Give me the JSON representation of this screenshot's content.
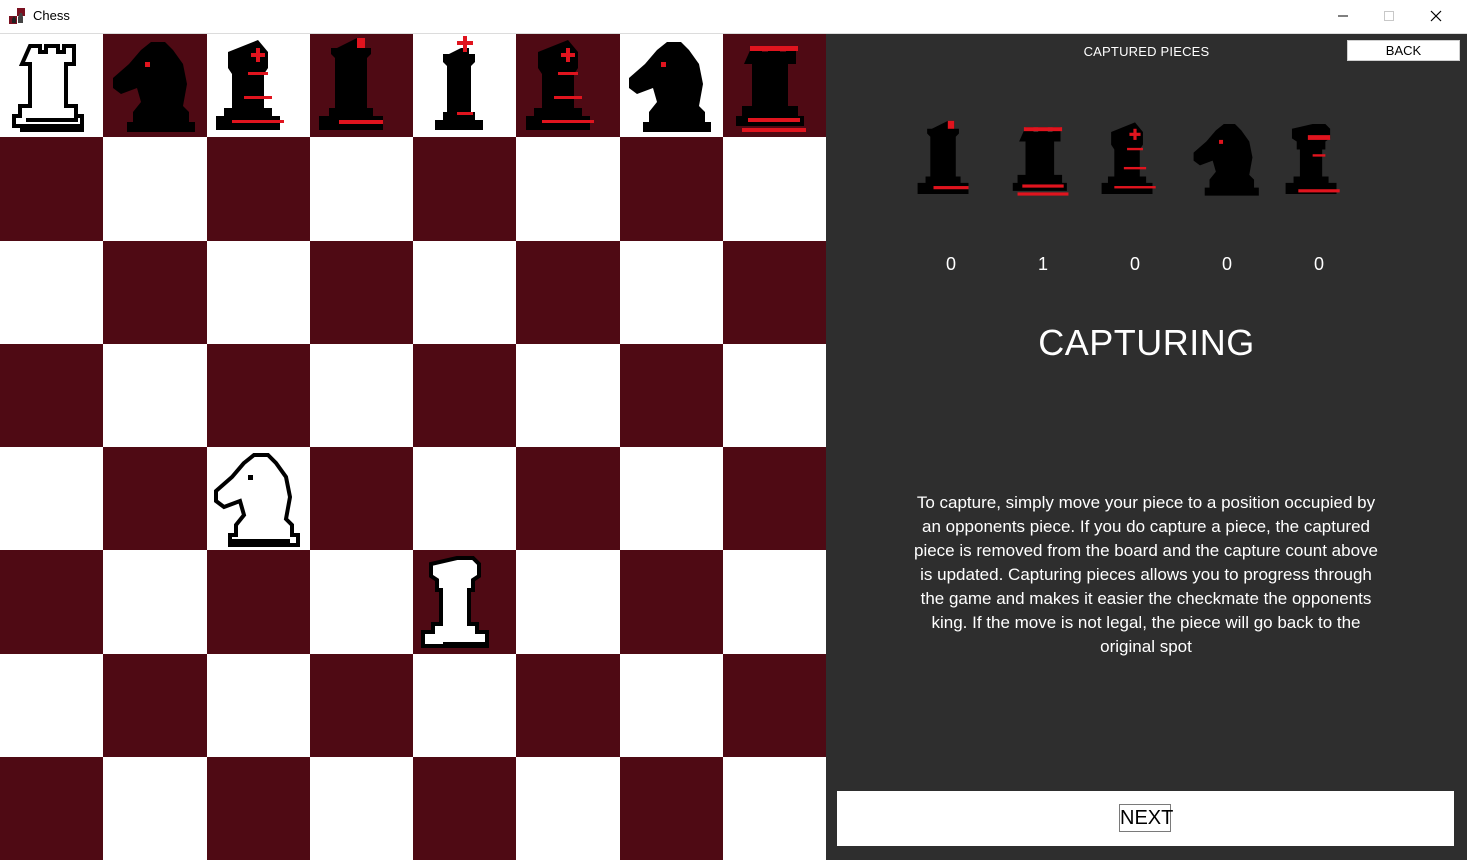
{
  "window": {
    "title": "Chess"
  },
  "colors": {
    "light_square": "#ffffff",
    "dark_square": "#4f0a14",
    "panel_bg": "#2e2e2e",
    "accent_red": "#e0141e"
  },
  "board": {
    "pieces": [
      {
        "row": 0,
        "col": 0,
        "piece": "rook",
        "color": "white"
      },
      {
        "row": 0,
        "col": 1,
        "piece": "knight",
        "color": "black"
      },
      {
        "row": 0,
        "col": 2,
        "piece": "bishop",
        "color": "black"
      },
      {
        "row": 0,
        "col": 3,
        "piece": "queen",
        "color": "black"
      },
      {
        "row": 0,
        "col": 4,
        "piece": "king",
        "color": "black"
      },
      {
        "row": 0,
        "col": 5,
        "piece": "bishop",
        "color": "black"
      },
      {
        "row": 0,
        "col": 6,
        "piece": "knight",
        "color": "black"
      },
      {
        "row": 0,
        "col": 7,
        "piece": "rook",
        "color": "black"
      },
      {
        "row": 4,
        "col": 2,
        "piece": "knight",
        "color": "white"
      },
      {
        "row": 5,
        "col": 4,
        "piece": "pawn",
        "color": "white"
      }
    ]
  },
  "panel": {
    "captured_title": "CAPTURED PIECES",
    "back_label": "BACK",
    "captured": [
      {
        "piece": "queen",
        "count": "0"
      },
      {
        "piece": "rook",
        "count": "1"
      },
      {
        "piece": "bishop",
        "count": "0"
      },
      {
        "piece": "knight",
        "count": "0"
      },
      {
        "piece": "pawn",
        "count": "0"
      }
    ],
    "heading": "CAPTURING",
    "description": "To capture, simply move your piece to a position occupied by an opponents piece. If you do capture a piece, the captured piece is removed from the board and the capture count above is updated. Capturing pieces allows you to progress through the game and makes it easier the checkmate the opponents king. If the move is not legal, the piece will go back to the original spot",
    "next_label": "NEXT"
  }
}
